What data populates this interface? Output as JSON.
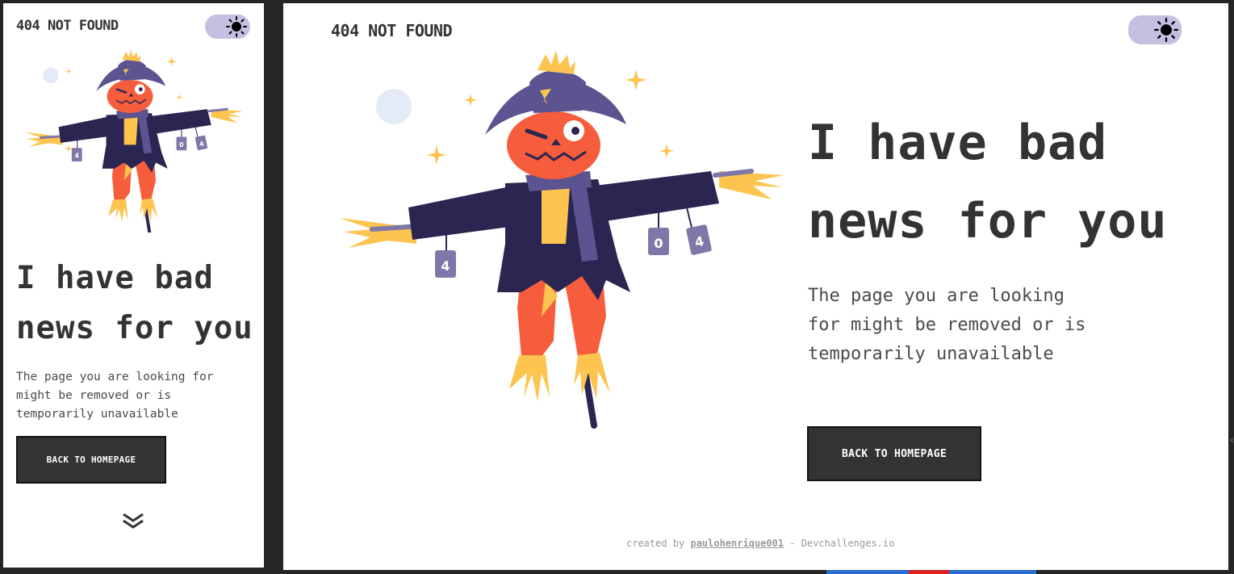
{
  "mobile": {
    "brand": "404 NOT FOUND",
    "headline_line1": "I have bad",
    "headline_line2": "news for you",
    "description_line1": "The page you are looking for",
    "description_line2": "might be removed or is",
    "description_line3": "temporarily unavailable",
    "button_label": "BACK TO HOMEPAGE",
    "scroll_icon": "double-chevron-down-icon"
  },
  "desktop": {
    "brand": "404 NOT FOUND",
    "headline_line1": "I have bad",
    "headline_line2": "news for you",
    "description_line1": "The page you are looking",
    "description_line2": "for might be removed or is",
    "description_line3": "temporarily unavailable",
    "button_label": "BACK TO HOMEPAGE",
    "footer_prefix": "created by",
    "footer_author": "paulohenrique001",
    "footer_suffix": "- Devchallenges.io"
  },
  "illustration": {
    "can_labels": [
      "4",
      "0",
      "4"
    ]
  },
  "theme_toggle_icon": "sun-icon",
  "colors": {
    "background": "#ffffff",
    "text": "#333333",
    "button": "#333333",
    "toggle_track": "#c5c0e2",
    "coat": "#2b2552",
    "hat": "#5c5491",
    "face": "#f65d3c",
    "straw": "#fdc44f",
    "can": "#7f77a8"
  }
}
